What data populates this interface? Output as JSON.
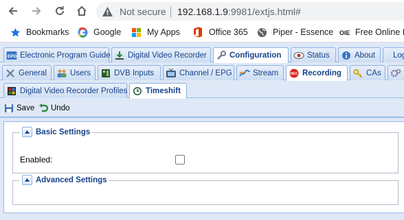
{
  "browser": {
    "security_label": "Not secure",
    "url_host": "192.168.1.9",
    "url_rest": ":9981/extjs.html#",
    "bookmarks": [
      {
        "label": "Bookmarks",
        "icon": "star-icon"
      },
      {
        "label": "Google",
        "icon": "google-icon"
      },
      {
        "label": "My Apps",
        "icon": "microsoft-icon"
      },
      {
        "label": "Office 365",
        "icon": "office-icon"
      },
      {
        "label": "Piper - Essence",
        "icon": "globe-icon"
      },
      {
        "label": "Free Online Ir",
        "icon": "oie-icon"
      }
    ]
  },
  "main_tabs": [
    {
      "label": "Electronic Program Guide",
      "icon": "epg-icon"
    },
    {
      "label": "Digital Video Recorder",
      "icon": "download-icon"
    },
    {
      "label": "Configuration",
      "icon": "wrench-icon",
      "active": true
    },
    {
      "label": "Status",
      "icon": "eye-icon"
    },
    {
      "label": "About",
      "icon": "info-icon"
    },
    {
      "label": "Log",
      "icon": ""
    }
  ],
  "config_tabs": [
    {
      "label": "General",
      "icon": "tools-icon"
    },
    {
      "label": "Users",
      "icon": "users-icon"
    },
    {
      "label": "DVB Inputs",
      "icon": "card-icon"
    },
    {
      "label": "Channel / EPG",
      "icon": "tv-icon"
    },
    {
      "label": "Stream",
      "icon": "stream-icon"
    },
    {
      "label": "Recording",
      "icon": "rec-icon",
      "active": true
    },
    {
      "label": "CAs",
      "icon": "key-icon"
    },
    {
      "label": "",
      "icon": "more-icon"
    }
  ],
  "recording_tabs": [
    {
      "label": "Digital Video Recorder Profiles",
      "icon": "dvr-profile-icon"
    },
    {
      "label": "Timeshift",
      "icon": "clock-icon",
      "active": true
    }
  ],
  "actions": {
    "save": "Save",
    "undo": "Undo"
  },
  "basic_settings": {
    "title": "Basic Settings",
    "enabled_label": "Enabled:",
    "enabled_value": false
  },
  "advanced_settings": {
    "title": "Advanced Settings"
  }
}
